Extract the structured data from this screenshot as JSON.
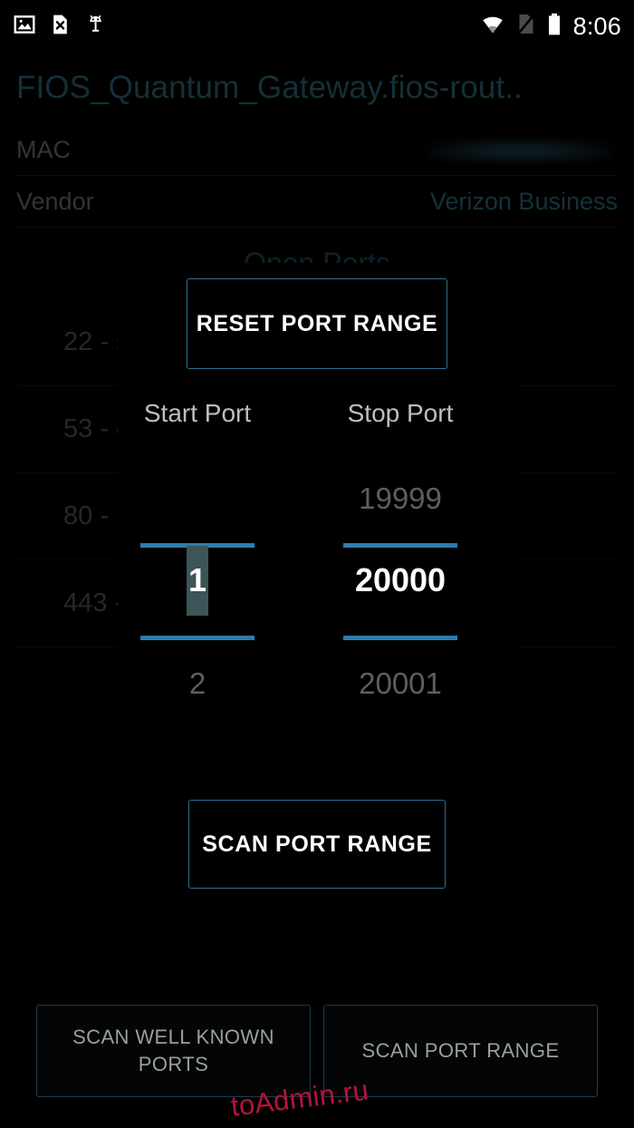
{
  "statusbar": {
    "time": "8:06",
    "left_icons": [
      {
        "name": "image-icon",
        "label": "image"
      },
      {
        "name": "file-error-icon",
        "label": "file-x"
      },
      {
        "name": "android-debug-icon",
        "label": "android"
      }
    ],
    "right_icons": [
      {
        "name": "wifi-icon",
        "label": "wifi"
      },
      {
        "name": "no-sim-icon",
        "label": "no-sim"
      },
      {
        "name": "battery-icon",
        "label": "battery"
      }
    ]
  },
  "background": {
    "device_title": "FIOS_Quantum_Gateway.fios-rout..",
    "rows": [
      {
        "label": "MAC",
        "value": "",
        "redacted": true
      },
      {
        "label": "Vendor",
        "value": "Verizon Business",
        "redacted": false
      }
    ],
    "open_ports_heading": "Open Ports",
    "ports": [
      {
        "label": "22 - ss"
      },
      {
        "label": "53 - d"
      },
      {
        "label": "80 - ht"
      },
      {
        "label": "443 - |"
      }
    ]
  },
  "dialog": {
    "reset_label": "RESET PORT RANGE",
    "scan_label": "SCAN PORT RANGE",
    "start_port": {
      "title": "Start Port",
      "previous": "",
      "current": "1",
      "next": "2"
    },
    "stop_port": {
      "title": "Stop Port",
      "previous": "19999",
      "current": "20000",
      "next": "20001"
    }
  },
  "bottom_bar": {
    "buttons": [
      {
        "label": "SCAN WELL KNOWN PORTS"
      },
      {
        "label": "SCAN PORT RANGE"
      }
    ]
  },
  "watermark": {
    "text": "toAdmin.ru"
  },
  "colors": {
    "accent_blue": "#2d7cad",
    "title_teal": "#2e6a7d",
    "selection_highlight": "#3d5458",
    "watermark_red": "#b5143c"
  }
}
